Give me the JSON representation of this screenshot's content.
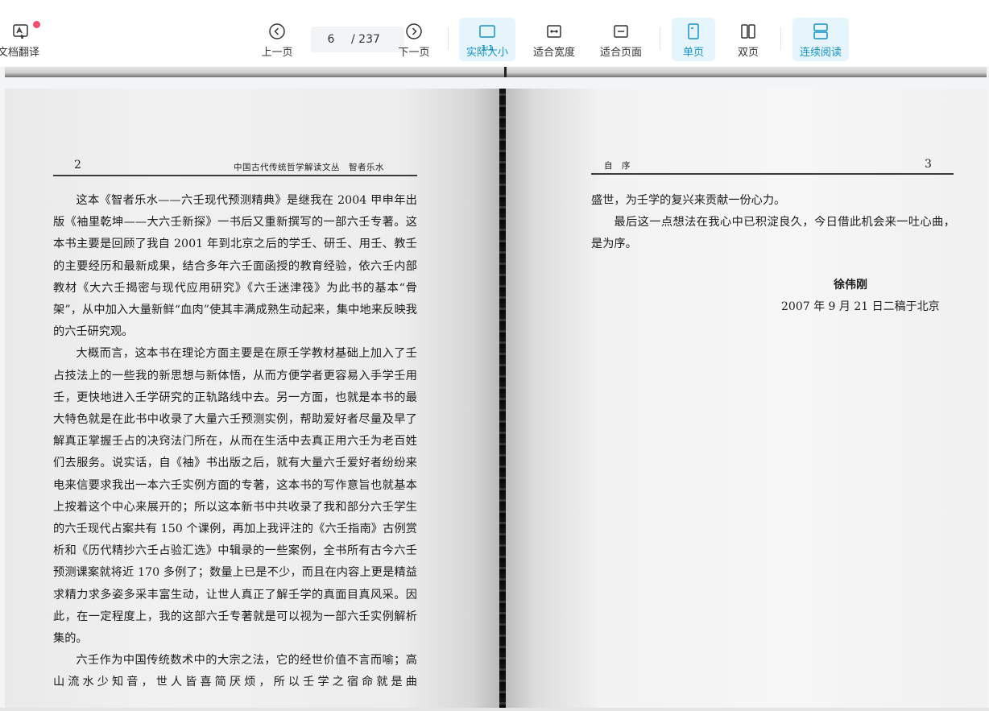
{
  "toolbar": {
    "translate_label": "文档翻译",
    "prev_label": "上一页",
    "current_page": "6",
    "total_pages": "/ 237",
    "next_label": "下一页",
    "actual_size_label": "实际大小",
    "fit_width_label": "适合宽度",
    "fit_page_label": "适合页面",
    "single_page_label": "单页",
    "double_page_label": "双页",
    "continuous_label": "连续阅读",
    "actual_size_icon_text": "1:1",
    "accent_color": "#1592c9",
    "active_bg": "#e6f4fb",
    "notify_dot_color": "#f0506e"
  },
  "left_page": {
    "page_number": "2",
    "header": "中国古代传统哲学解读文丛　智者乐水",
    "paragraphs": [
      "这本《智者乐水——六壬现代预测精典》是继我在 2004 甲申年出版《袖里乾坤——大六壬新探》一书后又重新撰写的一部六壬专著。这本书主要是回顾了我自 2001 年到北京之后的学壬、研壬、用壬、教壬的主要经历和最新成果，结合多年六壬面函授的教育经验，依六壬内部教材《大六壬揭密与现代应用研究》《六壬迷津筏》为此书的基本“骨架”，从中加入大量新鲜“血肉”使其丰满成熟生动起来，集中地来反映我的六壬研究观。",
      "大概而言，这本书在理论方面主要是在原壬学教材基础上加入了壬占技法上的一些我的新思想与新体悟，从而方便学者更容易入手学壬用壬，更快地进入壬学研究的正轨路线中去。另一方面，也就是本书的最大特色就是在此书中收录了大量六壬预测实例，帮助爱好者尽量及早了解真正掌握壬占的决窍法门所在，从而在生活中去真正用六壬为老百姓们去服务。说实话，自《袖》书出版之后，就有大量六壬爱好者纷纷来电来信要求我出一本六壬实例方面的专著，这本书的写作意旨也就基本上按着这个中心来展开的；所以这本新书中共收录了我和部分六壬学生的六壬现代占案共有 150 个课例，再加上我评注的《六壬指南》古例赏析和《历代精抄六壬占验汇选》中辑录的一些案例，全书所有古今六壬预测课案就将近 170 多例了；数量上已是不少，而且在内容上更是精益求精力求多姿多采丰富生动，让世人真正了解壬学的真面目真风采。因此，在一定程度上，我的这部六壬专著就是可以视为一部六壬实例解析集的。",
      "六壬作为中国传统数术中的大宗之法，它的经世价值不言而喻；高山流水少知音，世人皆喜简厌烦，所以壬学之宿命就是曲"
    ]
  },
  "right_page": {
    "page_number": "3",
    "header": "自　序",
    "paragraphs": [
      "盛世，为壬学的复兴来贡献一份心力。",
      "最后这一点想法在我心中已积淀良久，今日借此机会来一吐心曲，是为序。"
    ],
    "signature_name": "徐伟刚",
    "signature_date": "2007 年 9 月 21 日二稿于北京"
  }
}
